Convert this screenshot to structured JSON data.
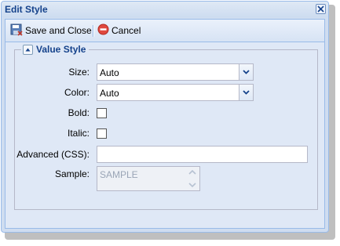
{
  "window": {
    "title": "Edit Style"
  },
  "toolbar": {
    "save_close_label": "Save and Close",
    "cancel_label": "Cancel"
  },
  "fieldset": {
    "title": "Value Style"
  },
  "fields": {
    "size": {
      "label": "Size:",
      "value": "Auto"
    },
    "color": {
      "label": "Color:",
      "value": "Auto"
    },
    "bold": {
      "label": "Bold:",
      "checked": false
    },
    "italic": {
      "label": "Italic:",
      "checked": false
    },
    "advanced_css": {
      "label": "Advanced (CSS):",
      "value": ""
    },
    "sample": {
      "label": "Sample:",
      "value": "SAMPLE"
    }
  },
  "colors": {
    "title_text": "#15428b",
    "panel_bg": "#dfe8f6",
    "border": "#99bbe8"
  },
  "icons": {
    "save": "save-icon",
    "cancel": "cancel-icon",
    "close": "close-icon",
    "collapse": "collapse-up-icon",
    "dropdown": "chevron-down-icon"
  }
}
